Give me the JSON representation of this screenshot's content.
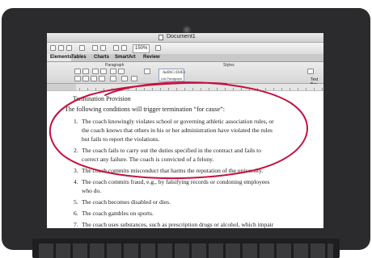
{
  "window": {
    "title": "Document1",
    "zoom": "150%"
  },
  "ribbon": {
    "tabs": [
      "Elements",
      "Tables",
      "Charts",
      "SmartArt",
      "Review"
    ],
    "active_tab": "Elements",
    "group_paragraph": "Paragraph",
    "group_styles": "Styles",
    "style_sample": "AaBbCcDdEe",
    "style_name": "List Paragraph",
    "text_box": "Text Box"
  },
  "document": {
    "heading": "Termination Provision",
    "intro": "The following conditions will trigger termination “for cause”:",
    "items": [
      {
        "num": "1.",
        "lines": [
          "The coach knowingly violates school or governing athletic association rules, or",
          "the coach knows that others in his or her administration have violated the rules",
          "but fails to report the violations."
        ]
      },
      {
        "num": "2.",
        "lines": [
          "The coach fails to carry out the duties specified in the contract and fails to",
          "correct any failure. The coach is convicted of a felony."
        ]
      },
      {
        "num": "3.",
        "lines": [
          "The coach commits misconduct that harms the reputation of the university."
        ]
      },
      {
        "num": "4.",
        "lines": [
          "The coach commits fraud, e.g., by falsifying records or condoning employees",
          "who do."
        ]
      },
      {
        "num": "5.",
        "lines": [
          "The coach becomes disabled or dies."
        ]
      },
      {
        "num": "6.",
        "lines": [
          "The coach gambles on sports."
        ]
      },
      {
        "num": "7.",
        "lines": [
          "The coach uses substances, such as prescription drugs or alcohol, which impair"
        ]
      }
    ]
  },
  "colors": {
    "annotation": "#c4123f",
    "bezel": "#2b2b2d"
  }
}
